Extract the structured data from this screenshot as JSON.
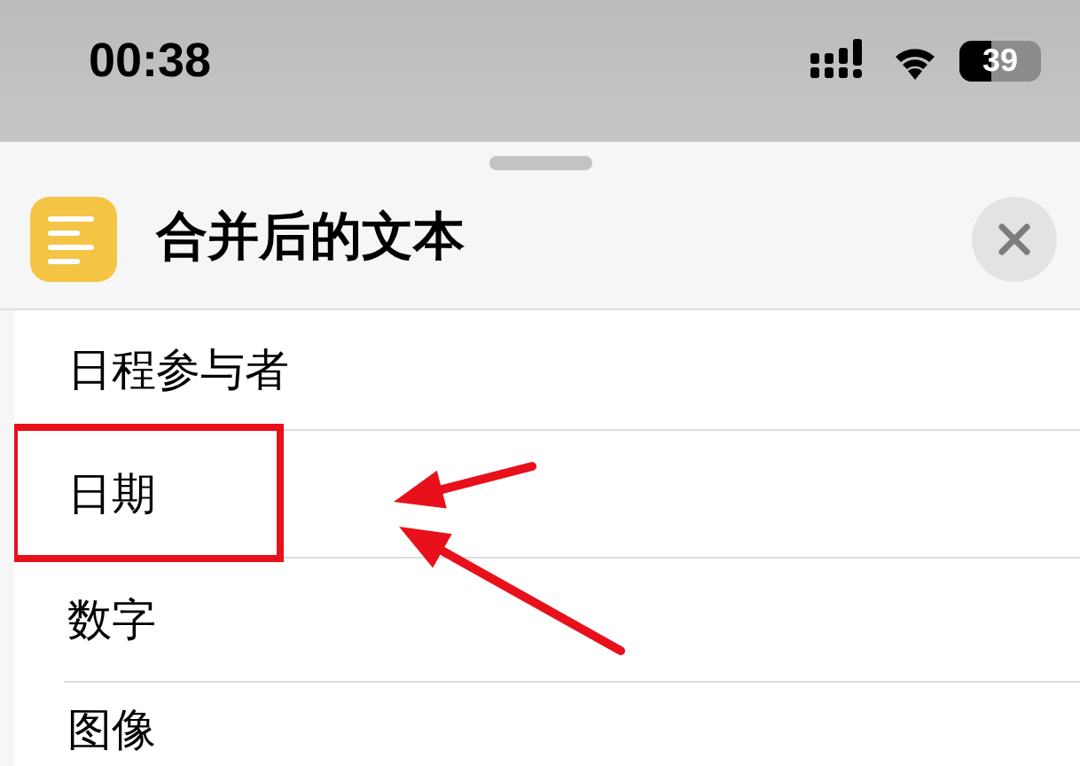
{
  "status_bar": {
    "time": "00:38",
    "battery": "39"
  },
  "sheet": {
    "title": "合并后的文本"
  },
  "rows": [
    {
      "label": "日程参与者",
      "highlighted": false
    },
    {
      "label": "日期",
      "highlighted": true
    },
    {
      "label": "数字",
      "highlighted": false
    },
    {
      "label": "图像",
      "highlighted": false
    }
  ]
}
